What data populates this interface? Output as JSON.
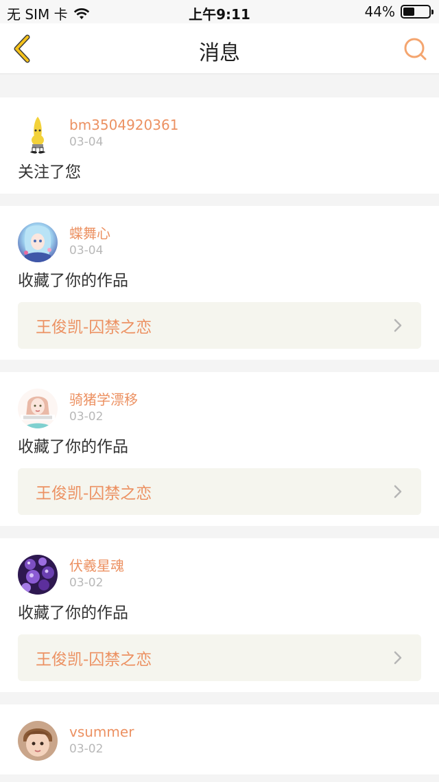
{
  "status_bar": {
    "carrier": "无 SIM 卡",
    "time": "上午9:11",
    "battery": "44%",
    "battery_level": 0.44
  },
  "nav": {
    "title": "消息",
    "back_icon": "chevron-left-icon",
    "search_icon": "search-icon"
  },
  "messages": [
    {
      "username": "bm3504920361",
      "date": "03-04",
      "action": "关注了您",
      "avatar": "banana-character-avatar"
    },
    {
      "username": "蝶舞心",
      "date": "03-04",
      "action": "收藏了你的作品",
      "work": "王俊凯-囚禁之恋",
      "avatar": "anime-girl-avatar"
    },
    {
      "username": "骑猪学漂移",
      "date": "03-02",
      "action": "收藏了你的作品",
      "work": "王俊凯-囚禁之恋",
      "avatar": "girl-photo-avatar"
    },
    {
      "username": "伏羲星魂",
      "date": "03-02",
      "action": "收藏了你的作品",
      "work": "王俊凯-囚禁之恋",
      "avatar": "purple-bubbles-avatar"
    },
    {
      "username": "vsummer",
      "date": "03-02",
      "avatar": "baby-photo-avatar"
    }
  ],
  "colors": {
    "accent": "#ec9162",
    "back_icon": "#f5c21b",
    "work_bg": "#f5f5ee",
    "page_bg": "#f4f4f4"
  }
}
